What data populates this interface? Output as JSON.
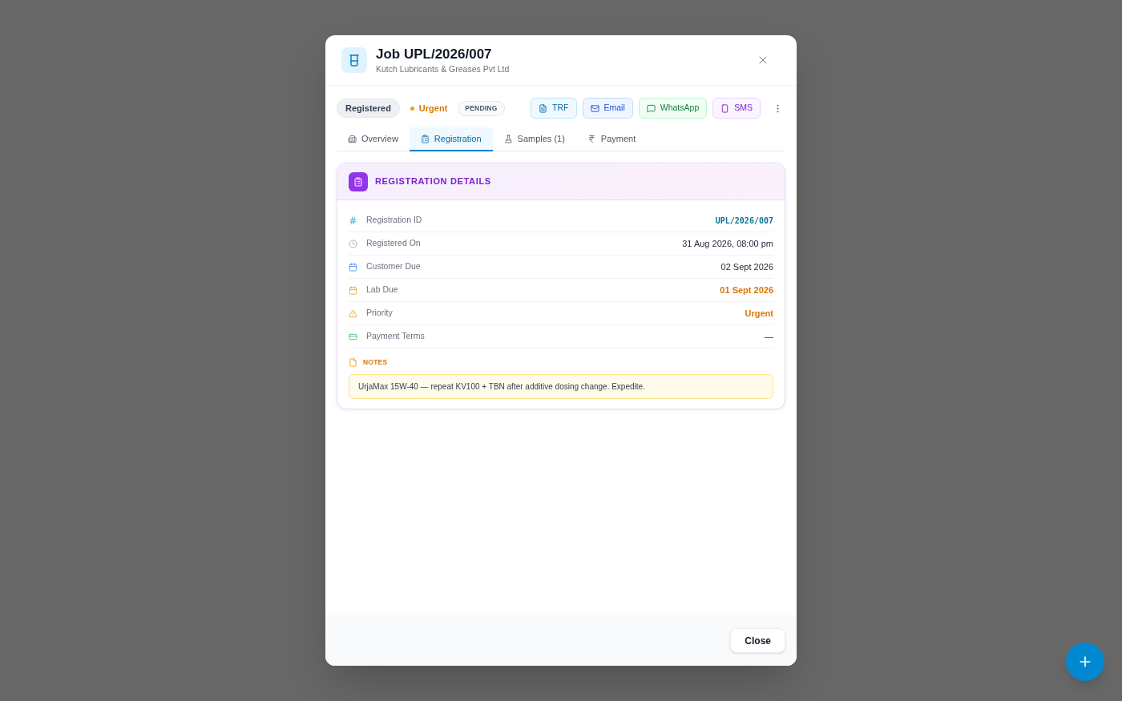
{
  "dialog": {
    "title": "Job UPL/2026/007",
    "subtitle": "Kutch Lubricants & Greases Pvt Ltd"
  },
  "status_badges": [
    {
      "kind": "status",
      "label": "Registered"
    },
    {
      "kind": "priority",
      "label": "Urgent"
    },
    {
      "kind": "stage",
      "label": "PENDING"
    }
  ],
  "actions": [
    {
      "kind": "document",
      "label": "TRF"
    },
    {
      "kind": "email",
      "label": "Email"
    },
    {
      "kind": "chat",
      "label": "WhatsApp"
    },
    {
      "kind": "phone",
      "label": "SMS"
    }
  ],
  "tabs": [
    {
      "label": "Overview",
      "selected": false
    },
    {
      "label": "Registration",
      "selected": true
    },
    {
      "label": "Samples (1)",
      "selected": false
    },
    {
      "label": "Payment",
      "selected": false
    }
  ],
  "details_card": {
    "title": "REGISTRATION DETAILS",
    "rows": [
      {
        "label": "Registration ID",
        "value": "UPL/2026/007",
        "kind": "id"
      },
      {
        "label": "Registered On",
        "value": "31 Aug 2026, 08:00 pm",
        "kind": "plain"
      },
      {
        "label": "Customer Due",
        "value": "02 Sept 2026",
        "kind": "plain"
      },
      {
        "label": "Lab Due",
        "value": "01 Sept 2026",
        "kind": "warning"
      },
      {
        "label": "Priority",
        "value": "Urgent",
        "kind": "warning"
      },
      {
        "label": "Payment Terms",
        "value": "—",
        "kind": "plain"
      }
    ],
    "notes": {
      "heading": "NOTES",
      "text": "UrjaMax 15W-40 — repeat KV100 + TBN after additive dosing change. Expedite."
    }
  },
  "footer": {
    "close_button": "Close"
  }
}
